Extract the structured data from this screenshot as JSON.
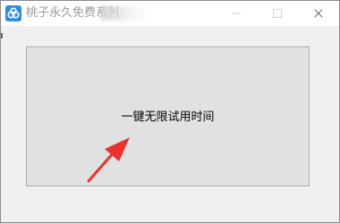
{
  "window": {
    "title": "桃子永久免费系列",
    "app_icon": "cloud-icon",
    "controls": {
      "minimize": "minimize-icon",
      "maximize": "maximize-icon",
      "close": "close-icon"
    }
  },
  "main": {
    "button_label": "一键无限试用时间",
    "annotation_arrow": {
      "icon": "red-arrow-icon",
      "color": "#e8342b"
    }
  },
  "colors": {
    "accent": "#2b8de4",
    "panel_background": "#e1e1e1"
  }
}
